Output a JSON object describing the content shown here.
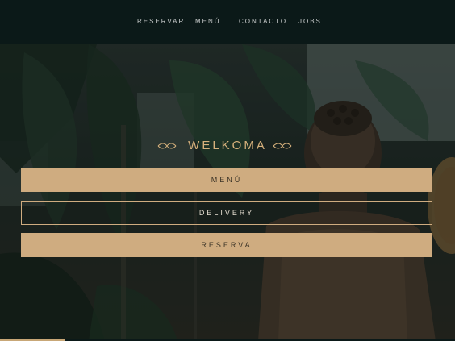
{
  "nav": {
    "items": [
      {
        "label": "RESERVAR"
      },
      {
        "label": "MENÚ"
      },
      {
        "label": "CONTACTO"
      },
      {
        "label": "JOBS"
      }
    ]
  },
  "hero": {
    "title": "WELKOMA",
    "buttons": [
      {
        "label": "MENÚ"
      },
      {
        "label": "DELIVERY"
      },
      {
        "label": "RESERVA"
      }
    ]
  },
  "colors": {
    "accent_gold": "#cfac80",
    "nav_background": "#0b1918",
    "title_gold": "#d6b17c"
  }
}
